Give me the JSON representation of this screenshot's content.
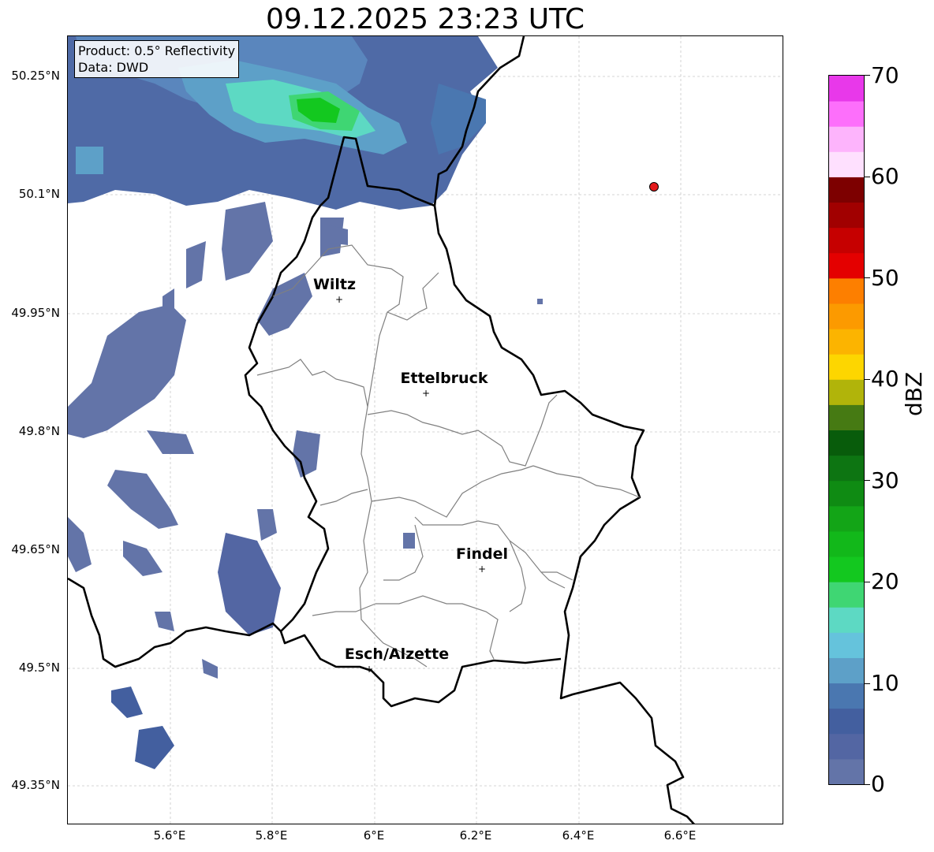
{
  "title": "09.12.2025 23:23 UTC",
  "info": {
    "product": "Product: 0.5° Reflectivity",
    "source": "Data: DWD"
  },
  "lat_labels": [
    "50.25°N",
    "50.1°N",
    "49.95°N",
    "49.8°N",
    "49.65°N",
    "49.5°N",
    "49.35°N"
  ],
  "lon_labels": [
    "5.6°E",
    "5.8°E",
    "6°E",
    "6.2°E",
    "6.4°E",
    "6.6°E"
  ],
  "cities": [
    {
      "name": "Wiltz"
    },
    {
      "name": "Ettelbruck"
    },
    {
      "name": "Findel"
    },
    {
      "name": "Esch/Alzette"
    }
  ],
  "colorbar": {
    "label": "dBZ",
    "ticks": [
      "70",
      "60",
      "50",
      "40",
      "30",
      "20",
      "10",
      "0"
    ],
    "range": [
      0,
      70
    ],
    "colors": [
      "#6374a8",
      "#5366a3",
      "#435f9f",
      "#4a77b0",
      "#5da0c8",
      "#65c3dc",
      "#5dd9c3",
      "#3fd673",
      "#13c81f",
      "#12b81a",
      "#13a517",
      "#0f8b13",
      "#0d7512",
      "#085c0b",
      "#467a13",
      "#b1b40a",
      "#fdd600",
      "#fcb400",
      "#fc9a00",
      "#fd7f00",
      "#e40000",
      "#c60000",
      "#a10000",
      "#7d0000",
      "#fee0fe",
      "#fdb4fc",
      "#fd6ffb",
      "#e838ea"
    ],
    "boundaries": [
      0,
      2.5,
      5,
      7.5,
      10,
      12.5,
      15,
      17.5,
      20,
      22.5,
      25,
      27.5,
      30,
      32.5,
      35,
      37.5,
      40,
      42.5,
      45,
      47.5,
      50,
      52.5,
      55,
      57.5,
      60,
      62.5,
      65,
      67.5,
      70
    ]
  },
  "marker": {
    "color": "#e41a1c"
  }
}
